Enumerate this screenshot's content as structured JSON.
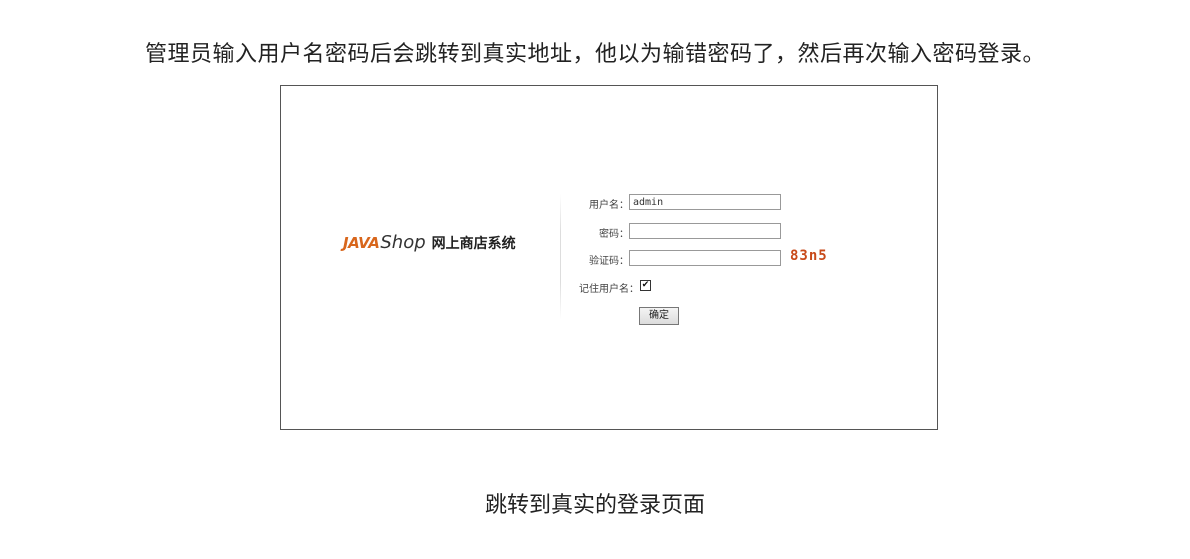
{
  "captions": {
    "top": "管理员输入用户名密码后会跳转到真实地址，他以为输错密码了，然后再次输入密码登录。",
    "bottom": "跳转到真实的登录页面"
  },
  "brand": {
    "java": "JAVA",
    "shop": "Shop",
    "system": "网上商店系统",
    "accent_color": "#d8661c"
  },
  "login": {
    "username_label": "用户名：",
    "username_value": "admin",
    "password_label": "密码：",
    "password_value": "",
    "captcha_label": "验证码：",
    "captcha_value": "",
    "captcha_code": "83n5",
    "remember_label": "记住用户名：",
    "remember_checked": true,
    "remember_mark": "✔",
    "submit_label": "确定"
  }
}
